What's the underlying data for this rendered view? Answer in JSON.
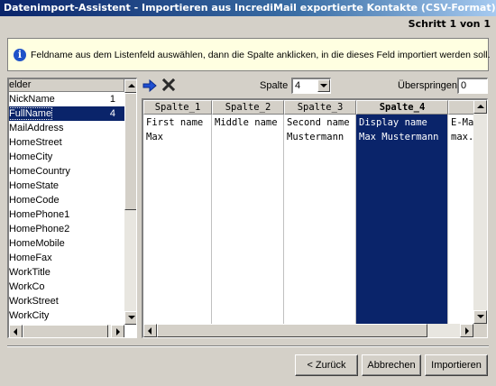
{
  "window": {
    "title": "Datenimport-Assistent - Importieren aus  IncrediMail exportierte Kontakte (CSV-Format).csv",
    "step": "Schritt 1 von 1"
  },
  "info": {
    "icon": "info-icon",
    "text": "Feldname aus dem Listenfeld auswählen, dann die Spalte anklicken, in die dieses Feld importiert werden soll."
  },
  "fields": {
    "header": "elder",
    "items": [
      {
        "label": "NickName",
        "num": "1"
      },
      {
        "label": "FullName",
        "num": "4"
      },
      {
        "label": "MailAddress",
        "num": ""
      },
      {
        "label": "HomeStreet",
        "num": ""
      },
      {
        "label": "HomeCity",
        "num": ""
      },
      {
        "label": "HomeCountry",
        "num": ""
      },
      {
        "label": "HomeState",
        "num": ""
      },
      {
        "label": "HomeCode",
        "num": ""
      },
      {
        "label": "HomePhone1",
        "num": ""
      },
      {
        "label": "HomePhone2",
        "num": ""
      },
      {
        "label": "HomeMobile",
        "num": ""
      },
      {
        "label": "HomeFax",
        "num": ""
      },
      {
        "label": "WorkTitle",
        "num": ""
      },
      {
        "label": "WorkCo",
        "num": ""
      },
      {
        "label": "WorkStreet",
        "num": ""
      },
      {
        "label": "WorkCity",
        "num": ""
      }
    ],
    "selected_index": 1
  },
  "toolbar": {
    "assign_icon": "arrow-right-icon",
    "remove_icon": "x-icon",
    "column_label": "Spalte",
    "column_value": "4",
    "skip_label": "Überspringen",
    "skip_value": "0"
  },
  "grid": {
    "columns": [
      {
        "header": "Spalte_1",
        "cells": [
          "First name",
          "Max"
        ]
      },
      {
        "header": "Spalte_2",
        "cells": [
          "Middle name",
          ""
        ]
      },
      {
        "header": "Spalte_3",
        "cells": [
          "Second name",
          "Mustermann"
        ]
      },
      {
        "header": "Spalte_4",
        "cells": [
          "Display name",
          "Max Mustermann"
        ]
      },
      {
        "header": "",
        "cells": [
          "E-Ma",
          "max."
        ]
      }
    ],
    "selected_column": 3
  },
  "buttons": {
    "back": "< Zurück",
    "cancel": "Abbrechen",
    "import": "Importieren"
  }
}
